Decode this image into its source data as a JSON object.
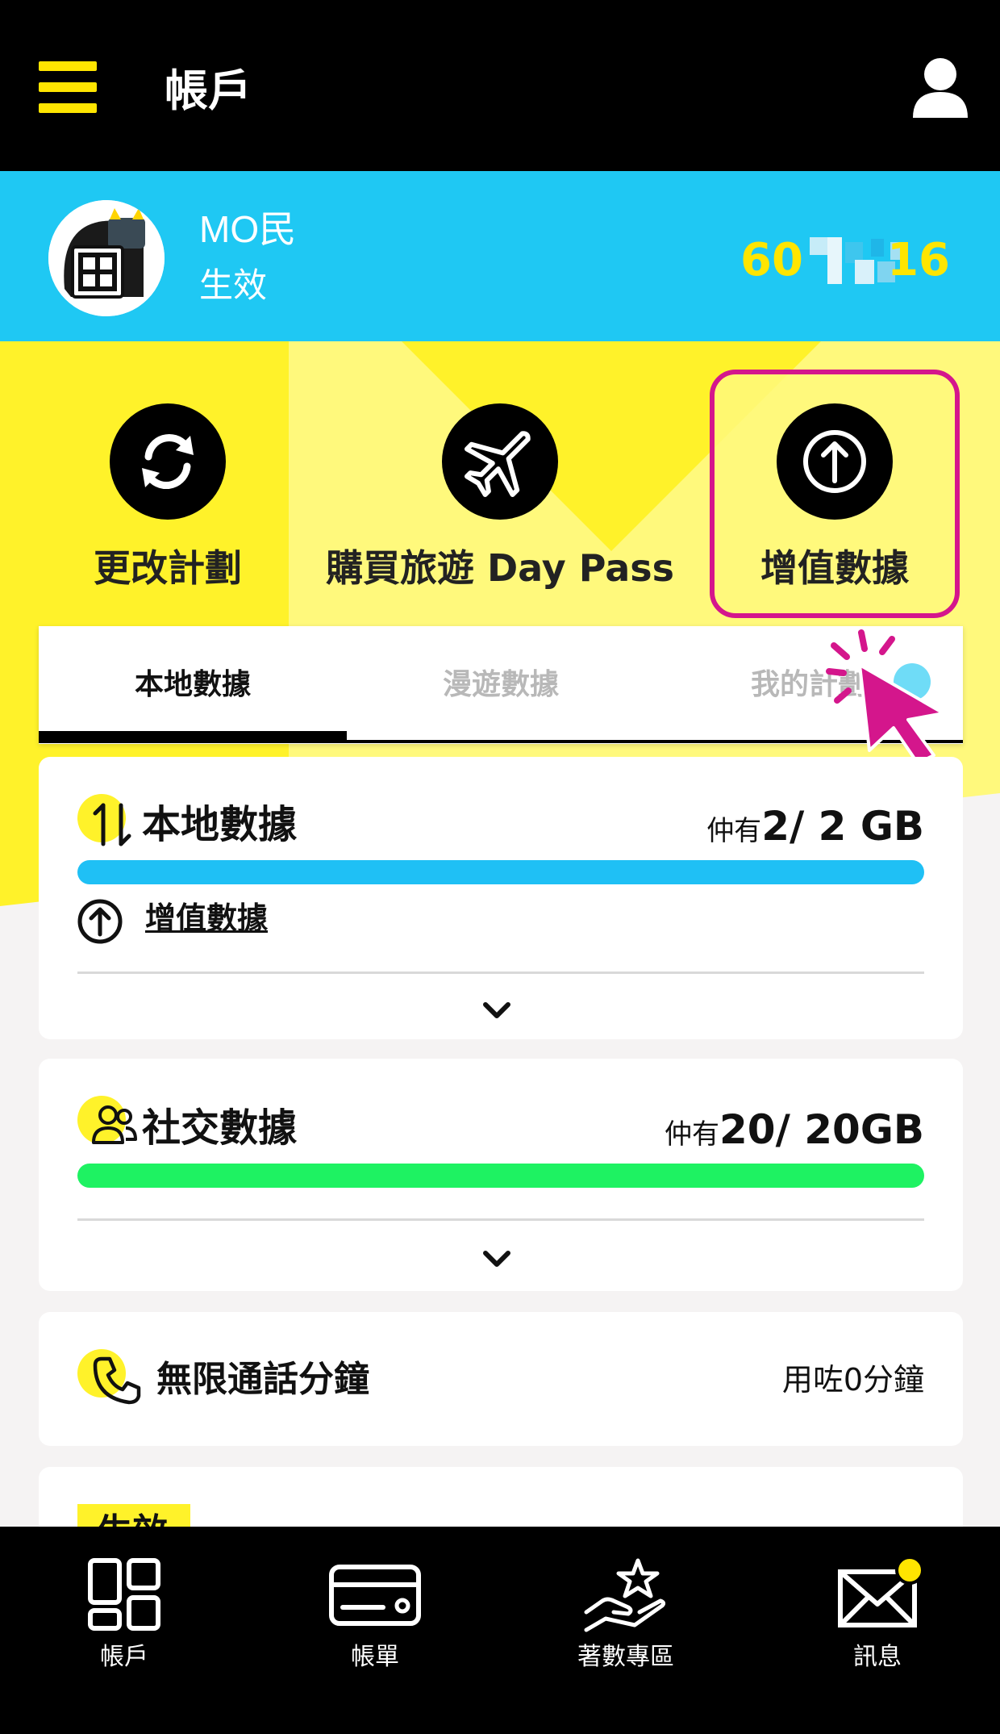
{
  "header": {
    "title": "帳戶",
    "menu_icon": "hamburger-menu-icon",
    "profile_icon": "user-profile-icon"
  },
  "account": {
    "name": "MO民",
    "status": "生效",
    "phone_prefix": "60",
    "phone_suffix": "16",
    "avatar_icon": "mascot-avatar"
  },
  "actions": [
    {
      "label": "更改計劃",
      "icon": "refresh-icon"
    },
    {
      "label": "購買旅遊 Day Pass",
      "icon": "airplane-icon"
    },
    {
      "label": "增值數據",
      "icon": "upload-arrow-icon"
    }
  ],
  "tabs": [
    {
      "label": "本地數據",
      "active": true
    },
    {
      "label": "漫遊數據",
      "active": false
    },
    {
      "label": "我的計劃",
      "active": false
    }
  ],
  "local_data": {
    "title": "本地數據",
    "remaining_prefix": "仲有",
    "remaining": "2/ 2 GB",
    "fill": 1.0,
    "topup_label": "增值數據",
    "bar_color": "#1fc0f5"
  },
  "social_data": {
    "title": "社交數據",
    "remaining_prefix": "仲有",
    "remaining": "20/ 20GB",
    "fill": 1.0,
    "bar_color": "#1ef262"
  },
  "calls": {
    "title": "無限通話分鐘",
    "used": "用咗0分鐘"
  },
  "partial_card": {
    "badge": "生效"
  },
  "bottom_nav": [
    {
      "label": "帳戶",
      "icon": "dashboard-icon"
    },
    {
      "label": "帳單",
      "icon": "credit-card-icon"
    },
    {
      "label": "著數專區",
      "icon": "star-hand-icon"
    },
    {
      "label": "訊息",
      "icon": "envelope-icon"
    }
  ],
  "colors": {
    "yellow": "#fff22a",
    "cyan": "#1fc8f3",
    "highlight": "#d4168c"
  }
}
